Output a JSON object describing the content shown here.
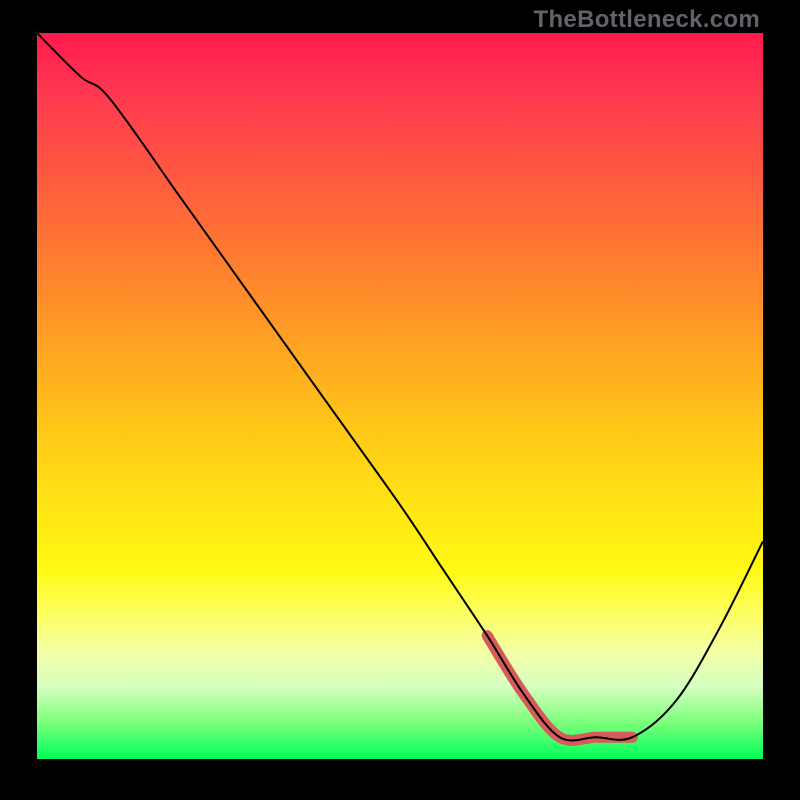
{
  "watermark": "TheBottleneck.com",
  "chart_data": {
    "type": "line",
    "title": "",
    "xlabel": "",
    "ylabel": "",
    "xlim": [
      0,
      100
    ],
    "ylim": [
      0,
      100
    ],
    "x": [
      0,
      6,
      10,
      20,
      30,
      40,
      50,
      56,
      62,
      67,
      72,
      77,
      82,
      88,
      94,
      100
    ],
    "values": [
      100,
      94,
      91,
      77,
      63,
      49,
      35,
      26,
      17,
      9,
      3,
      3,
      3,
      8,
      18,
      30
    ],
    "accent_range_x": [
      62,
      82
    ],
    "accent_note": "highlighted optimal region near curve minimum"
  }
}
